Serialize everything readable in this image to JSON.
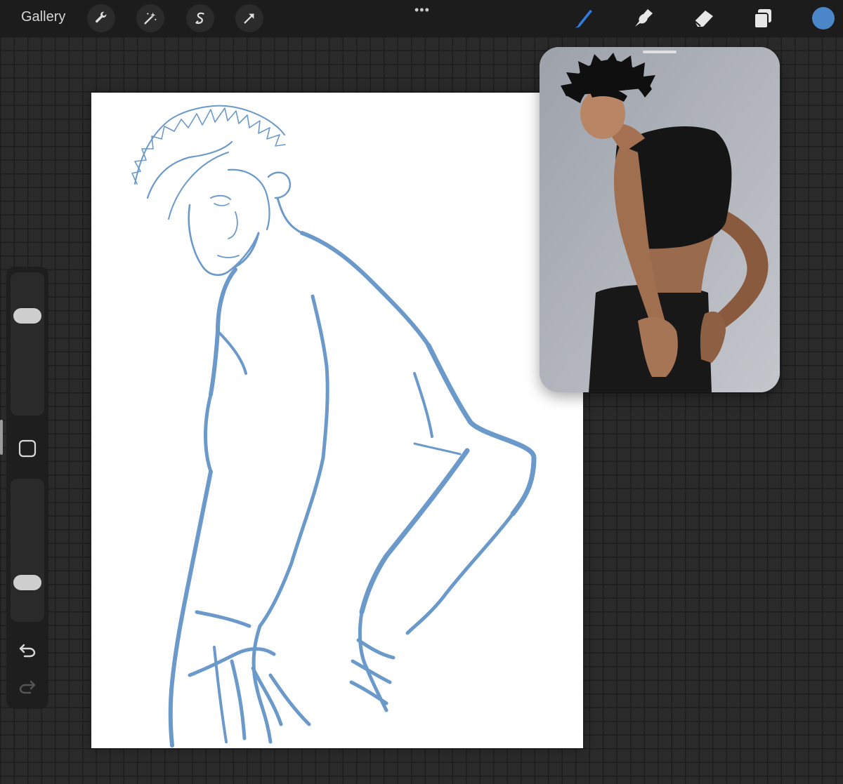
{
  "app": {
    "gallery_label": "Gallery",
    "more_icon": "ellipsis-icon"
  },
  "toolbar": {
    "left_tools": [
      "wrench-icon",
      "magic-wand-icon",
      "selection-s-icon",
      "transform-arrow-icon"
    ],
    "right_tools": [
      "brush-icon",
      "smudge-icon",
      "eraser-icon",
      "layers-icon"
    ],
    "active_tool": "brush-icon",
    "active_color": "#4a86c8",
    "accent_color": "#2f7de1"
  },
  "sidebar": {
    "brush_size_level": 0.72,
    "opacity_level": 0.25,
    "modify_button": "square-icon",
    "undo": "undo-icon",
    "redo": "redo-icon"
  },
  "canvas": {
    "sketch_color": "#5b8ec4",
    "background": "#ffffff"
  },
  "reference": {
    "image": "photo-reference-man-black-tank-top"
  }
}
